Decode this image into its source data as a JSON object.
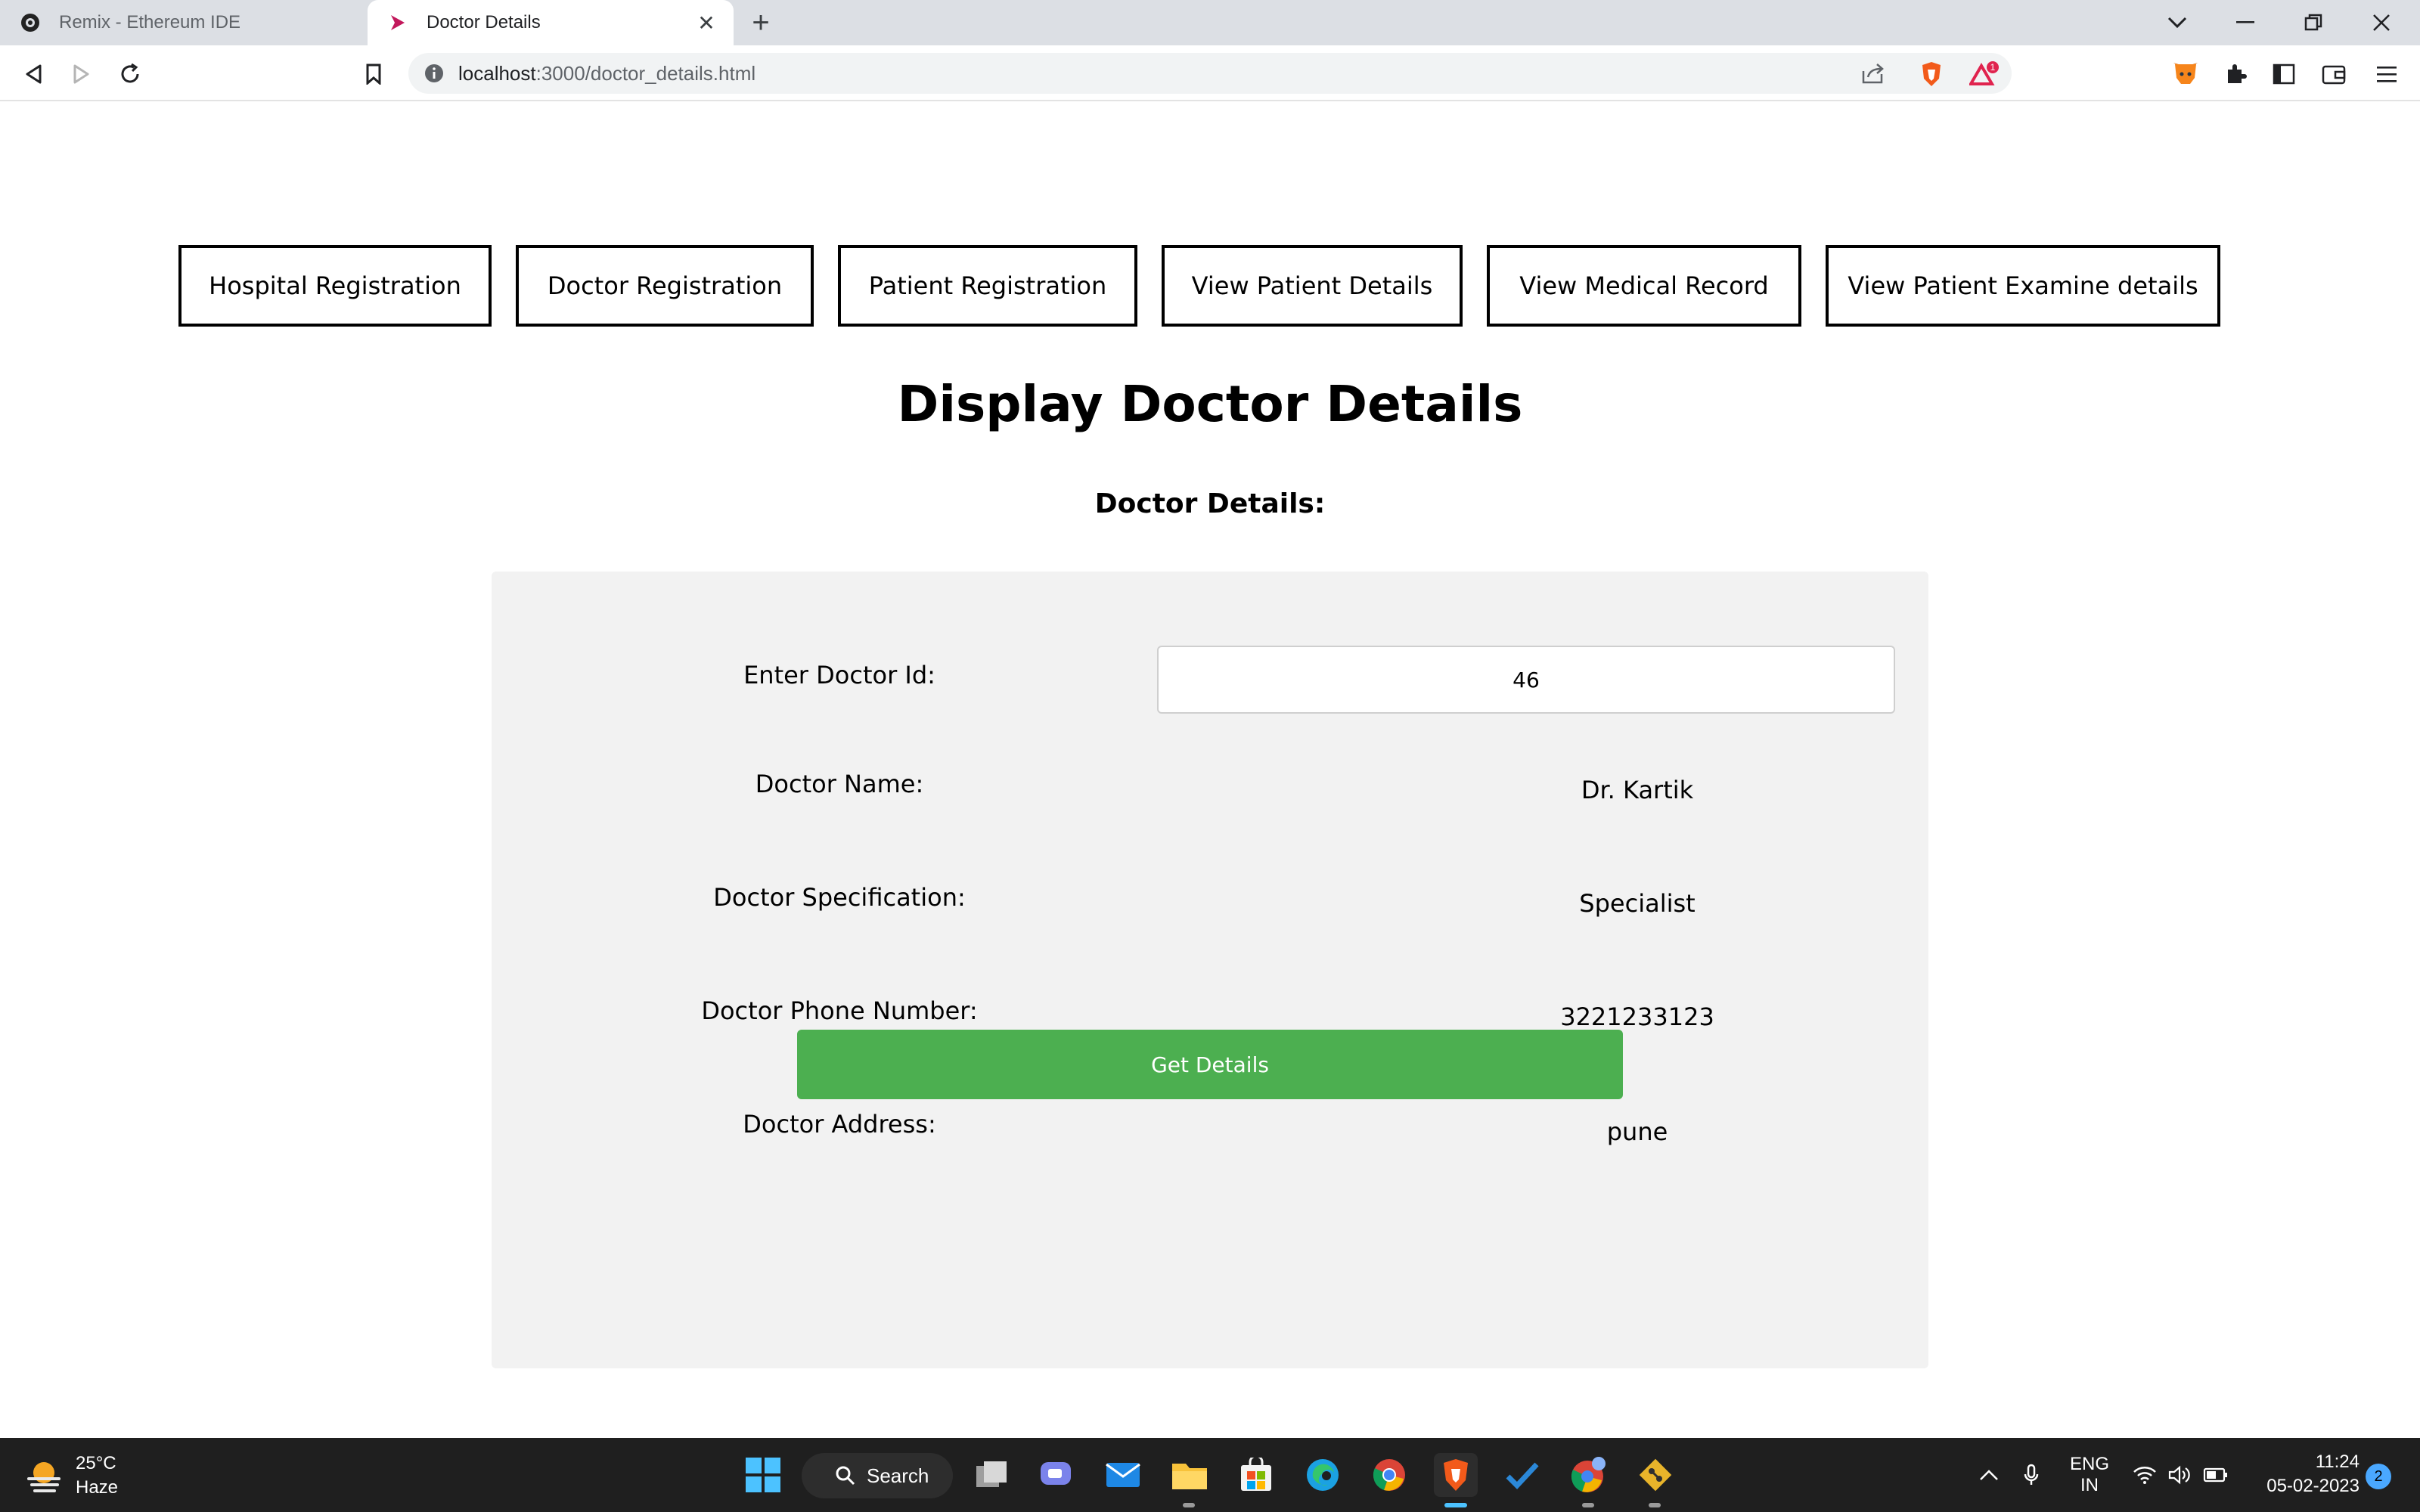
{
  "browser": {
    "tabs": [
      {
        "title": "Remix - Ethereum IDE",
        "active": false
      },
      {
        "title": "Doctor Details",
        "active": true
      }
    ],
    "address": {
      "host": "localhost",
      "path": ":3000/doctor_details.html"
    },
    "extension_badge": "1"
  },
  "nav": {
    "items": [
      {
        "label": "Hospital Registration"
      },
      {
        "label": "Doctor Registration"
      },
      {
        "label": "Patient Registration"
      },
      {
        "label": "View Patient Details"
      },
      {
        "label": "View Medical Record"
      },
      {
        "label": "View Patient Examine details"
      }
    ]
  },
  "page": {
    "title": "Display Doctor Details",
    "subtitle": "Doctor Details:"
  },
  "form": {
    "doctor_id_label": "Enter Doctor Id:",
    "doctor_id_value": "46",
    "fields": [
      {
        "label": "Doctor Name:",
        "value": "Dr. Kartik"
      },
      {
        "label": "Doctor Specification:",
        "value": "Specialist"
      },
      {
        "label": "Doctor Phone Number:",
        "value": "3221233123"
      },
      {
        "label": "Doctor Address:",
        "value": "pune"
      }
    ],
    "submit_label": "Get Details",
    "submit_color": "#4caf50"
  },
  "taskbar": {
    "weather_temp": "25°C",
    "weather_desc": "Haze",
    "search_label": "Search",
    "lang_line1": "ENG",
    "lang_line2": "IN",
    "time": "11:24",
    "date": "05-02-2023",
    "notification_count": "2"
  }
}
